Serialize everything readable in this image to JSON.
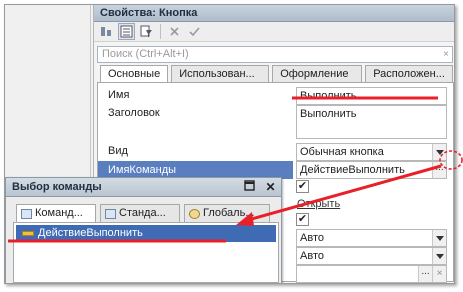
{
  "props_window": {
    "title": "Свойства: Кнопка",
    "toolbar": [
      "sort-icon",
      "list-icon",
      "filter-icon",
      "close-icon",
      "check-icon"
    ],
    "search_placeholder": "Поиск (Ctrl+Alt+I)",
    "tabs": [
      "Основные",
      "Использован...",
      "Оформление",
      "Расположен..."
    ],
    "active_tab": "Основные",
    "rows": {
      "name_label": "Имя",
      "name_value": "Выполнить",
      "caption_label": "Заголовок",
      "caption_value": "Выполнить",
      "view_label": "Вид",
      "view_value": "Обычная кнопка",
      "cmd_label": "ИмяКоманды",
      "cmd_value": "ДействиеВыполнить",
      "check1": "✔",
      "open_link": "Открыть",
      "check2": "✔",
      "auto1": "Авто",
      "auto2": "Авто",
      "dots": "..."
    }
  },
  "cmd_window": {
    "title": "Выбор команды",
    "tabs": [
      "Команд...",
      "Станда...",
      "Глобаль..."
    ],
    "active_tab": "Команд...",
    "item": "ДействиеВыполнить"
  },
  "annotation_color": "#e8202a",
  "selection_color": "#3f6bb5"
}
